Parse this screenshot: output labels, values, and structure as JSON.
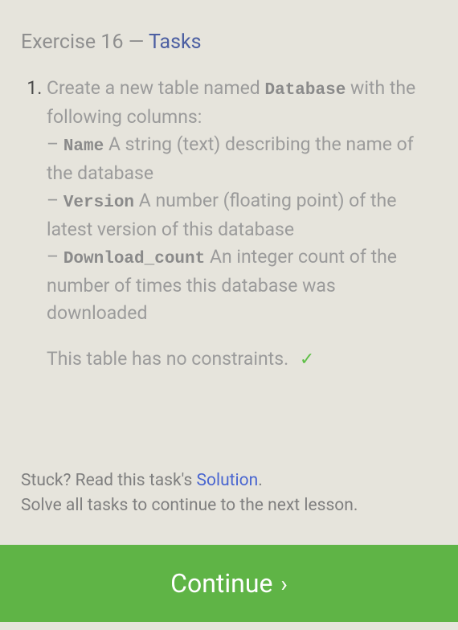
{
  "header": {
    "prefix": "Exercise 16",
    "separator": "—",
    "title": "Tasks"
  },
  "task": {
    "intro_before": "Create a new table named ",
    "table_name": "Database",
    "intro_after": " with the following columns:",
    "columns": [
      {
        "name": "Name",
        "desc": " A string (text) describing the name of the database"
      },
      {
        "name": "Version",
        "desc": " A number (floating point) of the latest version of this database"
      },
      {
        "name": "Download_count",
        "desc": " An integer count of the number of times this database was downloaded"
      }
    ],
    "constraints_text": "This table has no constraints.",
    "check_mark": "✓"
  },
  "footer": {
    "stuck_prefix": "Stuck? Read this task's ",
    "solution_label": "Solution",
    "stuck_suffix": ".",
    "solve_all": "Solve all tasks to continue to the next lesson."
  },
  "continue": {
    "label": "Continue",
    "chevron": "›"
  }
}
